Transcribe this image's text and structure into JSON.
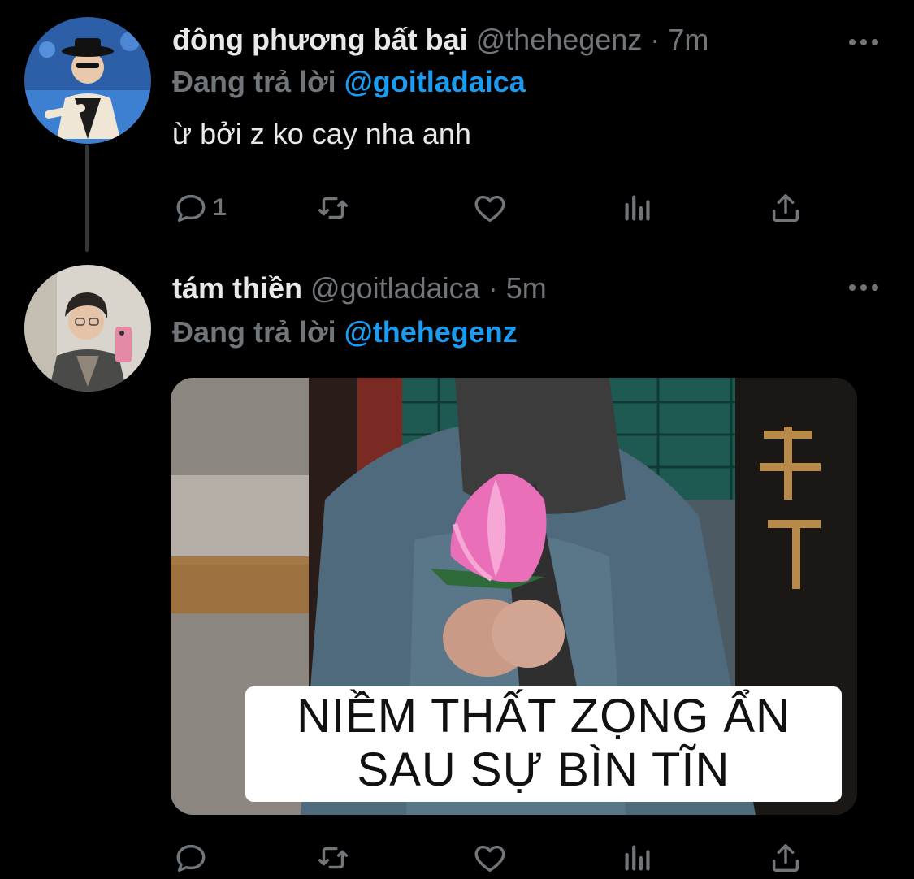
{
  "tweets": [
    {
      "display_name": "đông phương bất bại",
      "handle": "@thehegenz",
      "separator": "·",
      "time": "7m",
      "reply_prefix": "Đang trả lời",
      "reply_to": "@goitladaica",
      "text": "ừ bởi z ko cay nha anh",
      "actions": {
        "reply_count": "1",
        "icons": [
          "reply-icon",
          "retweet-icon",
          "like-icon",
          "analytics-icon",
          "share-icon"
        ]
      }
    },
    {
      "display_name": "tám thiền",
      "handle": "@goitladaica",
      "separator": "·",
      "time": "5m",
      "reply_prefix": "Đang trả lời",
      "reply_to": "@thehegenz",
      "media": {
        "caption_line1": "NIỀM THẤT ZỌNG ẨN",
        "caption_line2": "SAU SỰ BÌN TĨN"
      },
      "actions": {
        "icons": [
          "reply-icon",
          "retweet-icon",
          "like-icon",
          "analytics-icon",
          "share-icon"
        ]
      }
    }
  ],
  "colors": {
    "background": "#000000",
    "text": "#e7e9ea",
    "muted": "#71767b",
    "accent": "#1d9bf0"
  }
}
